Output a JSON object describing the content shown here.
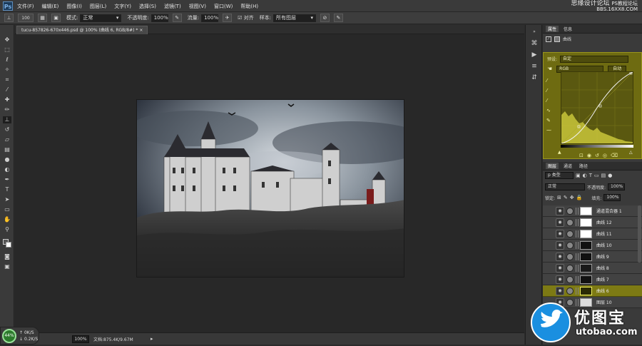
{
  "menubar": {
    "logo": "Ps",
    "menus": [
      "文件(F)",
      "编辑(E)",
      "图像(I)",
      "图层(L)",
      "文字(Y)",
      "选择(S)",
      "滤镜(T)",
      "视图(V)",
      "窗口(W)",
      "帮助(H)"
    ],
    "watermark_line1": "思缘设计论坛",
    "watermark_line2": "BBS.16XX8.COM",
    "watermark_line1_small": "PS教程论坛"
  },
  "options": {
    "brush_size": "100",
    "mode_label": "模式:",
    "mode_value": "正常",
    "opacity_label": "不透明度:",
    "opacity_value": "100%",
    "flow_label": "流量:",
    "flow_value": "100%",
    "aligned_label": "对齐",
    "sample_label": "样本:",
    "sample_value": "所有图层"
  },
  "document_tab": {
    "title": "tucu-857826-670x446.psd @ 100% (曲线 6, RGB/8#) *",
    "close": "×"
  },
  "status": {
    "zoom": "100%",
    "doc_info": "文档:875.4K/9.67M",
    "gauge_value": "44%",
    "speed_up": "0K/S",
    "speed_down": "0.2K/S"
  },
  "properties": {
    "tab_props": "属性",
    "tab_info": "信息",
    "panel_title": "曲线",
    "preset_label": "预设:",
    "preset_value": "自定",
    "channel_value": "RGB",
    "auto_button": "自动"
  },
  "layers_panel": {
    "tabs": [
      "图层",
      "通道",
      "路径"
    ],
    "filter_value": "p 类型",
    "blend_value": "正常",
    "opacity_label": "不透明度:",
    "opacity_value": "100%",
    "lock_label": "锁定:",
    "fill_label": "填充:",
    "fill_value": "100%",
    "layers": [
      {
        "name": "通道混合器 1",
        "selected": false
      },
      {
        "name": "曲线 12",
        "selected": false
      },
      {
        "name": "曲线 11",
        "selected": false
      },
      {
        "name": "曲线 10",
        "selected": false
      },
      {
        "name": "曲线 9",
        "selected": false
      },
      {
        "name": "曲线 8",
        "selected": false
      },
      {
        "name": "曲线 7",
        "selected": false
      },
      {
        "name": "曲线 6",
        "selected": true
      },
      {
        "name": "图层 10",
        "selected": false
      }
    ]
  },
  "brand": {
    "name": "优图宝",
    "url": "utobao.com"
  },
  "colors": {
    "selection_yellow": "#7d7a14",
    "properties_bg": "#6e6b11",
    "brand_blue": "#1a8fe0"
  }
}
